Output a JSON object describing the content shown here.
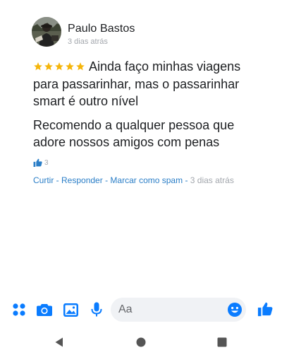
{
  "review": {
    "author": "Paulo Bastos",
    "time_top": "3 dias atrás",
    "rating": 5,
    "text1": "Ainda faço minhas viagens para passarinhar, mas o passarinhar smart é outro nível",
    "text2": "Recomendo a qualquer pessoa que adore nossos amigos com penas",
    "like_count": "3",
    "actions": {
      "like": "Curtir",
      "reply": "Responder",
      "spam": "Marcar como spam",
      "separator": " - ",
      "time": "3 dias atrás"
    }
  },
  "composer": {
    "placeholder": "Aa",
    "icons": [
      "menu-dots-icon",
      "camera-icon",
      "gallery-icon",
      "microphone-icon",
      "emoji-icon",
      "thumbs-up-icon"
    ]
  },
  "navbar": {
    "icons": [
      "back-icon",
      "home-icon",
      "recents-icon"
    ]
  },
  "colors": {
    "accent": "#0a7cff",
    "link": "#2a7ec7",
    "star": "#f5b50a",
    "muted": "#a3a7ad"
  }
}
